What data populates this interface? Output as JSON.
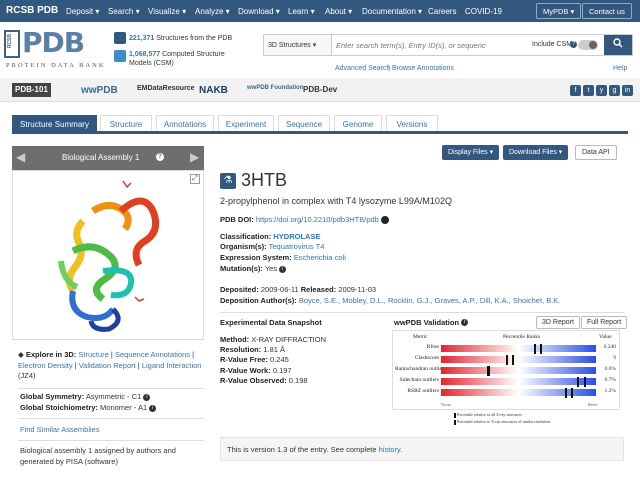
{
  "nav": {
    "brand": "RCSB PDB",
    "items": [
      "Deposit ▾",
      "Search ▾",
      "Visualize ▾",
      "Analyze ▾",
      "Download ▾",
      "Learn ▾",
      "About ▾",
      "Documentation ▾",
      "Careers",
      "COVID-19"
    ],
    "mypdb": "MyPDB ▾",
    "contact": "Contact us"
  },
  "header": {
    "logo": "PDB",
    "logo_side": "RCSB",
    "logo_sub": "PROTEIN DATA BANK",
    "stats": [
      {
        "count": "221,371",
        "label": "Structures from the PDB"
      },
      {
        "count": "1,068,577",
        "label": "Computed Structure",
        "label2": "Models (CSM)"
      }
    ],
    "search": {
      "scope": "3D Structures ▾",
      "placeholder": "Enter search term(s), Entry ID(s), or sequence",
      "csm_label": "Include CSM",
      "csm_info": "?"
    },
    "advanced": "Advanced Search",
    "browse": "Browse Annotations",
    "help": "Help",
    "pipe": "|"
  },
  "partners": [
    "PDB-101",
    "wwPDB",
    "EMDataResource",
    "NAKB",
    "wwPDB Foundation",
    "PDB-Dev"
  ],
  "social": [
    "f",
    "t",
    "y",
    "g",
    "in"
  ],
  "tabs": [
    "Structure Summary",
    "Structure",
    "Annotations",
    "Experiment",
    "Sequence",
    "Genome",
    "Versions"
  ],
  "assembly": {
    "title": "Biological Assembly 1",
    "info": "?",
    "explore_label": "Explore in 3D:",
    "explore_links": [
      "Structure",
      "Sequence Annotations",
      "Electron Density",
      "Validation Report",
      "Ligand Interaction"
    ],
    "ligand_code": "(JZ4)",
    "symmetry_label": "Global Symmetry:",
    "symmetry": "Asymmetric - C1",
    "stoich_label": "Global Stoichiometry:",
    "stoich": "Monomer - A1",
    "similar": "Find Similar Assemblies",
    "note1": "Biological assembly 1 assigned by authors and",
    "note2": "generated by PISA (software)"
  },
  "entry": {
    "id": "3HTB",
    "title": "2-propylphenol in complex with T4 lysozyme L99A/M102Q",
    "doi_label": "PDB DOI:",
    "doi": "https://doi.org/10.2210/pdb3HTB/pdb",
    "classification_label": "Classification:",
    "classification": "HYDROLASE",
    "organism_label": "Organism(s):",
    "organism": "Tequatrovirus T4",
    "expression_label": "Expression System:",
    "expression": "Escherichia coli",
    "mutation_label": "Mutation(s):",
    "mutation": "Yes",
    "deposited_label": "Deposited:",
    "deposited": "2009-06-11",
    "released_label": "Released:",
    "released": "2009-11-03",
    "authors_label": "Deposition Author(s):",
    "authors": "Boyce, S.E., Mobley, D.L., Rocklin, G.J., Graves, A.P., Dill, K.A., Shoichet, B.K."
  },
  "buttons": {
    "display": "Display Files ▾",
    "download": "Download Files ▾",
    "api": "Data API"
  },
  "snapshot": {
    "heading": "Experimental Data Snapshot",
    "method_label": "Method:",
    "method": "X-RAY DIFFRACTION",
    "resolution_label": "Resolution:",
    "resolution": "1.81 Å",
    "rfree_label": "R-Value Free:",
    "rfree": "0.245",
    "rwork_label": "R-Value Work:",
    "rwork": "0.197",
    "robs_label": "R-Value Observed:",
    "robs": "0.198"
  },
  "validation": {
    "heading": "wwPDB Validation",
    "btn3d": "3D Report",
    "btnfull": "Full Report",
    "col_metric": "Metric",
    "col_ranks": "Percentile Ranks",
    "col_value": "Value",
    "metrics": [
      {
        "name": "Rfree",
        "value": "0.240",
        "pct_all": 0.6,
        "pct_res": 0.62
      },
      {
        "name": "Clashscore",
        "value": "9",
        "pct_all": 0.42,
        "pct_res": 0.44
      },
      {
        "name": "Ramachandran outliers",
        "value": "0.6%",
        "pct_all": 0.3,
        "pct_res": 0.28
      },
      {
        "name": "Sidechain outliers",
        "value": "0.7%",
        "pct_all": 0.88,
        "pct_res": 0.9
      },
      {
        "name": "RSRZ outliers",
        "value": "1.2%",
        "pct_all": 0.8,
        "pct_res": 0.82
      }
    ],
    "scale_worse": "Worse",
    "scale_better": "Better",
    "legend1": "Percentile relative to all X-ray structures",
    "legend2": "Percentile relative to X-ray structures of similar resolution"
  },
  "history": {
    "text": "This is version 1.3 of the entry. See complete",
    "link": "history."
  },
  "colors": {
    "nav": "#325880",
    "link": "#3576b0",
    "validation_red": "#e0262f",
    "validation_blue": "#2b4fe0"
  }
}
